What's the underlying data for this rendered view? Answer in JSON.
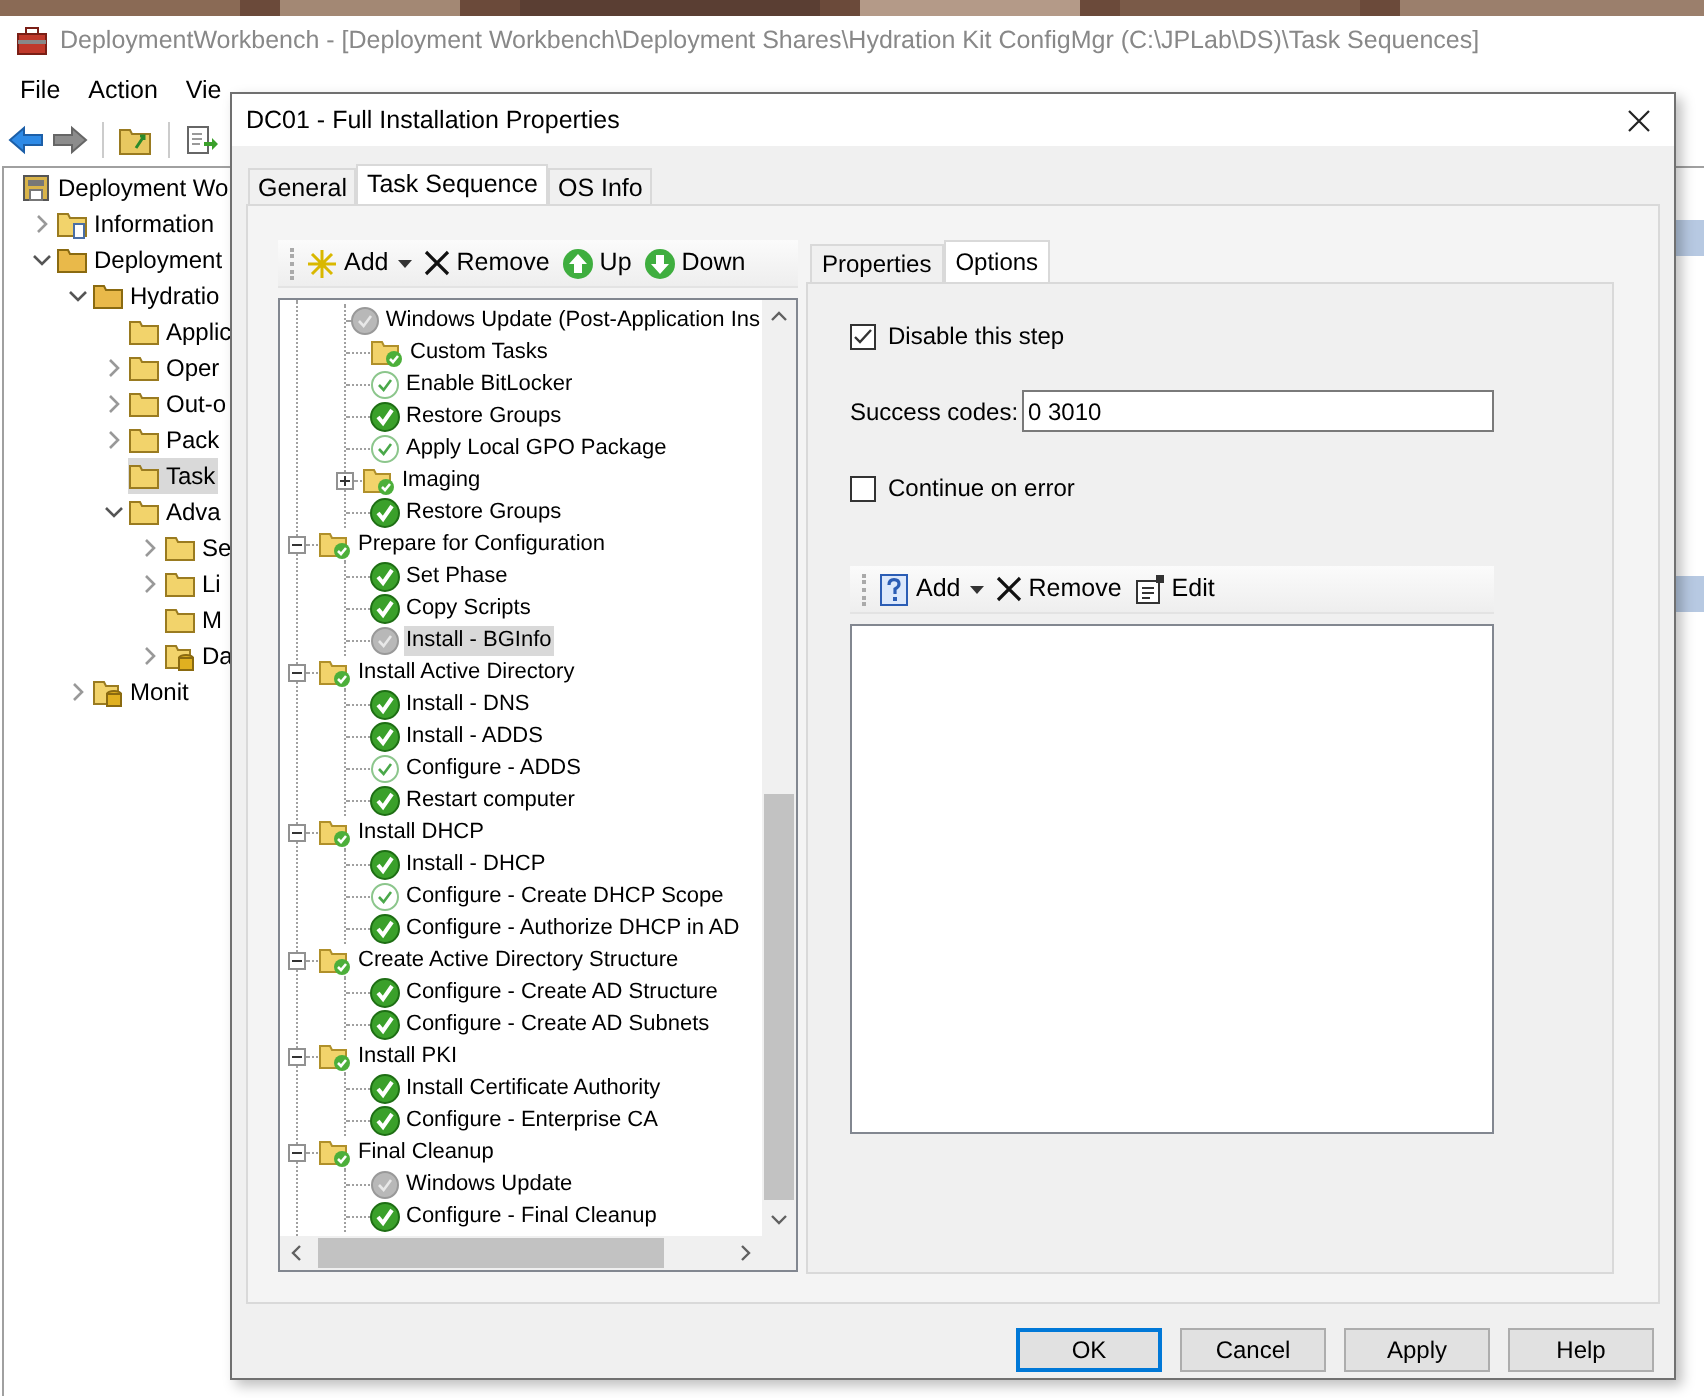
{
  "window": {
    "title": "DeploymentWorkbench - [Deployment Workbench\\Deployment Shares\\Hydration Kit ConfigMgr (C:\\JPLab\\DS)\\Task Sequences]"
  },
  "menu": [
    "File",
    "Action",
    "Vie"
  ],
  "tree": [
    {
      "label": "Deployment Wo",
      "kind": "root",
      "selected": false,
      "children": [
        {
          "label": "Information",
          "kind": "info",
          "expanded": false,
          "selected": false
        },
        {
          "label": "Deployment",
          "kind": "share",
          "expanded": true,
          "selected": false,
          "children": [
            {
              "label": "Hydratio",
              "kind": "share",
              "expanded": true,
              "selected": false,
              "children": [
                {
                  "label": "Applic",
                  "kind": "folder",
                  "selected": false
                },
                {
                  "label": "Oper",
                  "kind": "folder",
                  "expanded": false,
                  "selected": false
                },
                {
                  "label": "Out-o",
                  "kind": "folder",
                  "expanded": false,
                  "selected": false
                },
                {
                  "label": "Pack",
                  "kind": "folder",
                  "expanded": false,
                  "selected": false
                },
                {
                  "label": "Task",
                  "kind": "folder",
                  "selected": true
                },
                {
                  "label": "Adva",
                  "kind": "folder",
                  "expanded": true,
                  "selected": false,
                  "children": [
                    {
                      "label": "Se",
                      "kind": "folder",
                      "expanded": false,
                      "selected": false
                    },
                    {
                      "label": "Li",
                      "kind": "folder",
                      "expanded": false,
                      "selected": false
                    },
                    {
                      "label": "M",
                      "kind": "folder",
                      "selected": false
                    },
                    {
                      "label": "Da",
                      "kind": "store",
                      "expanded": false,
                      "selected": false
                    }
                  ]
                }
              ]
            },
            {
              "label": "Monit",
              "kind": "store",
              "expanded": false,
              "selected": false
            }
          ]
        }
      ]
    }
  ],
  "dialog": {
    "title": "DC01 - Full Installation Properties",
    "tabs": [
      {
        "label": "General",
        "selected": false
      },
      {
        "label": "Task Sequence",
        "selected": true
      },
      {
        "label": "OS Info",
        "selected": false
      }
    ],
    "sequence_toolbar": [
      {
        "kind": "add",
        "label": "Add"
      },
      {
        "kind": "remove",
        "label": "Remove"
      },
      {
        "kind": "up",
        "label": "Up"
      },
      {
        "kind": "down",
        "label": "Down"
      }
    ],
    "task_tree": [
      {
        "children": [
          {
            "label": "Windows Update (Post-Application Ins",
            "kind": "step",
            "disabled": true,
            "selected": false
          },
          {
            "label": "Custom Tasks",
            "kind": "group",
            "selected": false
          },
          {
            "label": "Enable BitLocker",
            "kind": "outlinestep",
            "disabled": false,
            "selected": false
          },
          {
            "label": "Restore Groups",
            "kind": "step",
            "disabled": false,
            "selected": false
          },
          {
            "label": "Apply Local GPO Package",
            "kind": "outlinestep",
            "disabled": false,
            "selected": false
          },
          {
            "label": "Imaging",
            "kind": "group",
            "expanded": false,
            "selected": false
          },
          {
            "label": "Restore Groups",
            "kind": "step",
            "disabled": false,
            "selected": false
          }
        ]
      },
      {
        "label": "Prepare for Configuration",
        "expanded": true,
        "selected": false,
        "children": [
          {
            "label": "Set Phase",
            "kind": "step",
            "disabled": false,
            "selected": false
          },
          {
            "label": "Copy Scripts",
            "kind": "step",
            "disabled": false,
            "selected": false
          },
          {
            "label": "Install - BGInfo",
            "kind": "step",
            "disabled": true,
            "selected": true
          }
        ]
      },
      {
        "label": "Install Active Directory",
        "expanded": true,
        "selected": false,
        "children": [
          {
            "label": "Install - DNS",
            "kind": "step",
            "disabled": false,
            "selected": false
          },
          {
            "label": "Install - ADDS",
            "kind": "step",
            "disabled": false,
            "selected": false
          },
          {
            "label": "Configure - ADDS",
            "kind": "outlinestep",
            "disabled": false,
            "selected": false
          },
          {
            "label": "Restart computer",
            "kind": "step",
            "disabled": false,
            "selected": false
          }
        ]
      },
      {
        "label": "Install DHCP",
        "expanded": true,
        "selected": false,
        "children": [
          {
            "label": "Install - DHCP",
            "kind": "step",
            "disabled": false,
            "selected": false
          },
          {
            "label": "Configure - Create DHCP Scope",
            "kind": "outlinestep",
            "disabled": false,
            "selected": false
          },
          {
            "label": "Configure - Authorize DHCP in AD",
            "kind": "step",
            "disabled": false,
            "selected": false
          }
        ]
      },
      {
        "label": "Create Active Directory Structure",
        "expanded": true,
        "selected": false,
        "children": [
          {
            "label": "Configure - Create AD Structure",
            "kind": "step",
            "disabled": false,
            "selected": false
          },
          {
            "label": "Configure - Create AD Subnets",
            "kind": "step",
            "disabled": false,
            "selected": false
          }
        ]
      },
      {
        "label": "Install PKI",
        "expanded": true,
        "selected": false,
        "children": [
          {
            "label": "Install Certificate Authority",
            "kind": "step",
            "disabled": false,
            "selected": false
          },
          {
            "label": "Configure - Enterprise CA",
            "kind": "step",
            "disabled": false,
            "selected": false
          }
        ]
      },
      {
        "label": "Final Cleanup",
        "expanded": true,
        "selected": false,
        "children": [
          {
            "label": "Windows Update",
            "kind": "step",
            "disabled": true,
            "selected": false
          },
          {
            "label": "Configure - Final Cleanup",
            "kind": "step",
            "disabled": false,
            "selected": false
          }
        ]
      }
    ],
    "step_tabs": [
      {
        "label": "Properties",
        "selected": false
      },
      {
        "label": "Options",
        "selected": true
      }
    ],
    "options": {
      "disable_step": {
        "label": "Disable this step",
        "checked": true
      },
      "success_codes": {
        "label": "Success codes:",
        "value": "0 3010"
      },
      "continue_on_error": {
        "label": "Continue on error",
        "checked": false
      },
      "condition_toolbar": [
        {
          "kind": "add",
          "label": "Add"
        },
        {
          "kind": "remove",
          "label": "Remove"
        },
        {
          "kind": "edit",
          "label": "Edit"
        }
      ]
    },
    "buttons": [
      {
        "label": "OK",
        "default": true
      },
      {
        "label": "Cancel",
        "default": false
      },
      {
        "label": "Apply",
        "default": false
      },
      {
        "label": "Help",
        "default": false
      }
    ]
  }
}
